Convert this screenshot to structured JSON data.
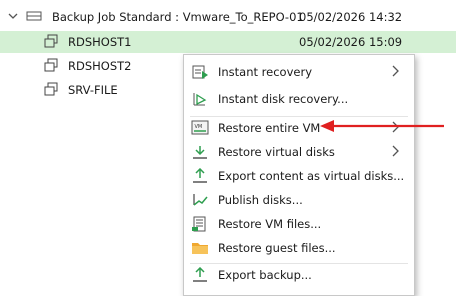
{
  "tree": {
    "job": {
      "label": "Backup Job Standard : Vmware_To_REPO-01",
      "date": "05/02/2026 14:32",
      "expanded": true
    },
    "vms": [
      {
        "label": "RDSHOST1",
        "date": "05/02/2026 15:09",
        "selected": true
      },
      {
        "label": "RDSHOST2",
        "date": ""
      },
      {
        "label": "SRV-FILE",
        "date": ""
      }
    ]
  },
  "context_menu": {
    "items": [
      {
        "label": "Instant recovery",
        "icon": "instant-recovery-icon",
        "submenu": true
      },
      {
        "label": "Instant disk recovery...",
        "icon": "instant-disk-recovery-icon",
        "submenu": false
      },
      {
        "label": "Restore entire VM",
        "icon": "restore-vm-icon",
        "submenu": true,
        "highlighted_by_annotation": true
      },
      {
        "label": "Restore virtual disks",
        "icon": "restore-disks-icon",
        "submenu": true
      },
      {
        "label": "Export content as virtual disks...",
        "icon": "export-disks-icon",
        "submenu": false
      },
      {
        "label": "Publish disks...",
        "icon": "publish-disks-icon",
        "submenu": false
      },
      {
        "label": "Restore VM files...",
        "icon": "restore-files-icon",
        "submenu": false
      },
      {
        "label": "Restore guest files...",
        "icon": "folder-icon",
        "submenu": false
      },
      {
        "label": "Export backup...",
        "icon": "export-backup-icon",
        "submenu": false
      }
    ]
  },
  "annotation": {
    "arrow_color": "#e02020"
  },
  "colors": {
    "selected_row": "#d4f0d4",
    "icon_green": "#2e9e4f",
    "icon_orange": "#f0a830"
  }
}
